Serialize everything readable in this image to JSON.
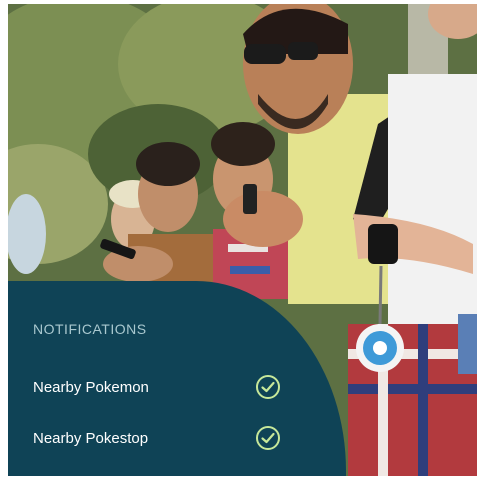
{
  "notifications": {
    "title": "NOTIFICATIONS",
    "items": [
      {
        "label": "Nearby Pokemon",
        "icon": "check-circle-icon"
      },
      {
        "label": "Nearby Pokestop",
        "icon": "check-circle-icon"
      }
    ]
  },
  "colors": {
    "panel": "#0f4356",
    "title": "#a9c8cf",
    "check": "#c7e89a"
  }
}
